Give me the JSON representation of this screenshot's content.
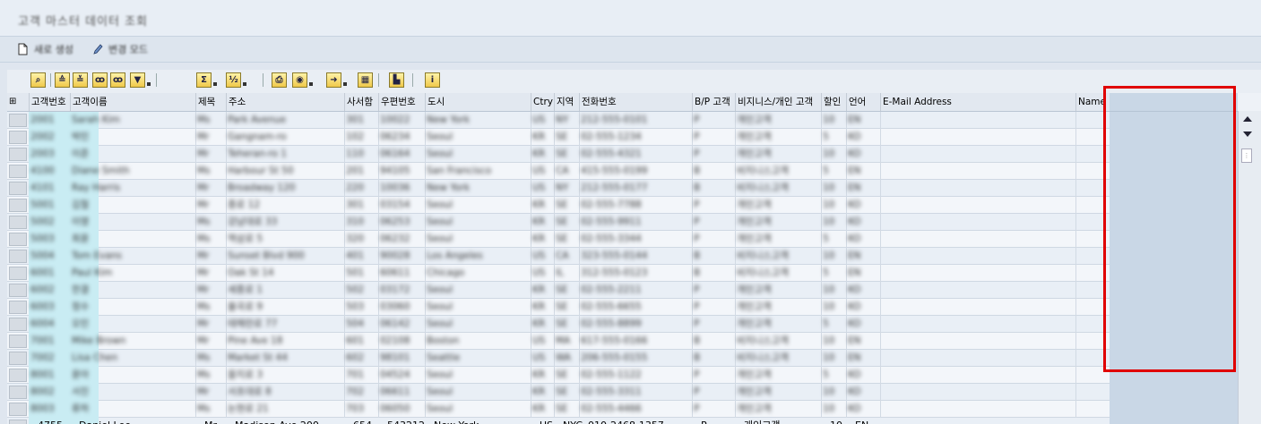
{
  "window": {
    "title": "고객 마스터 데이터 조회"
  },
  "actions": [
    {
      "label": "새로 생성",
      "icon": "new-document-icon"
    },
    {
      "label": "변경 모드",
      "icon": "pencil-icon"
    }
  ],
  "toolbar": {
    "buttons": [
      {
        "name": "details-button",
        "icon": "magnify-icon"
      },
      {
        "name": "sort-ascending-button",
        "icon": "sort-asc-icon"
      },
      {
        "name": "sort-descending-button",
        "icon": "sort-desc-icon"
      },
      {
        "name": "find-button",
        "icon": "binoculars-icon"
      },
      {
        "name": "find-next-button",
        "icon": "binoculars-next-icon"
      },
      {
        "name": "filter-button",
        "icon": "filter-icon"
      },
      {
        "name": "total-button",
        "icon": "sigma-icon"
      },
      {
        "name": "subtotal-button",
        "icon": "subtotal-icon"
      },
      {
        "name": "print-button",
        "icon": "printer-icon"
      },
      {
        "name": "views-button",
        "icon": "views-icon"
      },
      {
        "name": "export-button",
        "icon": "export-icon"
      },
      {
        "name": "layout-button",
        "icon": "grid-icon"
      },
      {
        "name": "graphic-button",
        "icon": "chart-icon"
      },
      {
        "name": "info-button",
        "icon": "info-icon"
      }
    ]
  },
  "table": {
    "columns": [
      "고객번호",
      "고객이름",
      "제목",
      "주소",
      "사서함",
      "우편번호",
      "도시",
      "Ctry",
      "지역",
      "전화번호",
      "B/P 고객",
      "비지니스/개인 고객",
      "할인",
      "언어",
      "E-Mail Address",
      "Name"
    ],
    "blurred_rows": [
      [
        "2001",
        "Sarah Kim",
        "Ms",
        "Park Avenue",
        "301",
        "10022",
        "New York",
        "US",
        "NY",
        "212-555-0101",
        "P",
        "개인고객",
        "10",
        "EN"
      ],
      [
        "2002",
        "박민",
        "Mr",
        "Gangnam-ro",
        "102",
        "06234",
        "Seoul",
        "KR",
        "SE",
        "02-555-1234",
        "P",
        "개인고객",
        "5",
        "KO"
      ],
      [
        "2003",
        "이준",
        "Mr",
        "Teheran-ro 1",
        "110",
        "06164",
        "Seoul",
        "KR",
        "SE",
        "02-555-4321",
        "P",
        "개인고객",
        "10",
        "KO"
      ],
      [
        "4100",
        "Diane Smith",
        "Ms",
        "Harbour St 50",
        "201",
        "94105",
        "San Francisco",
        "US",
        "CA",
        "415-555-0199",
        "B",
        "비지니스고객",
        "5",
        "EN"
      ],
      [
        "4101",
        "Ray Harris",
        "Mr",
        "Broadway 120",
        "220",
        "10036",
        "New York",
        "US",
        "NY",
        "212-555-0177",
        "B",
        "비지니스고객",
        "10",
        "EN"
      ],
      [
        "5001",
        "김철",
        "Mr",
        "종로 12",
        "301",
        "03154",
        "Seoul",
        "KR",
        "SE",
        "02-555-7788",
        "P",
        "개인고객",
        "10",
        "KO"
      ],
      [
        "5002",
        "이영",
        "Ms",
        "강남대로 33",
        "310",
        "06253",
        "Seoul",
        "KR",
        "SE",
        "02-555-9911",
        "P",
        "개인고객",
        "10",
        "KO"
      ],
      [
        "5003",
        "최윤",
        "Ms",
        "역삼로 5",
        "320",
        "06232",
        "Seoul",
        "KR",
        "SE",
        "02-555-3344",
        "P",
        "개인고객",
        "5",
        "KO"
      ],
      [
        "5004",
        "Tom Evans",
        "Mr",
        "Sunset Blvd 900",
        "401",
        "90028",
        "Los Angeles",
        "US",
        "CA",
        "323-555-0144",
        "B",
        "비지니스고객",
        "10",
        "EN"
      ],
      [
        "6001",
        "Paul Kim",
        "Mr",
        "Oak St 14",
        "501",
        "60611",
        "Chicago",
        "US",
        "IL",
        "312-555-0123",
        "B",
        "비지니스고객",
        "5",
        "EN"
      ],
      [
        "6002",
        "한결",
        "Mr",
        "세종로 1",
        "502",
        "03172",
        "Seoul",
        "KR",
        "SE",
        "02-555-2211",
        "P",
        "개인고객",
        "10",
        "KO"
      ],
      [
        "6003",
        "정수",
        "Ms",
        "율곡로 9",
        "503",
        "03060",
        "Seoul",
        "KR",
        "SE",
        "02-555-6655",
        "P",
        "개인고객",
        "10",
        "KO"
      ],
      [
        "6004",
        "오민",
        "Mr",
        "테헤란로 77",
        "504",
        "06142",
        "Seoul",
        "KR",
        "SE",
        "02-555-8899",
        "P",
        "개인고객",
        "5",
        "KO"
      ],
      [
        "7001",
        "Mike Brown",
        "Mr",
        "Pine Ave 18",
        "601",
        "02108",
        "Boston",
        "US",
        "MA",
        "617-555-0166",
        "B",
        "비지니스고객",
        "10",
        "EN"
      ],
      [
        "7002",
        "Lisa Chen",
        "Ms",
        "Market St 44",
        "602",
        "98101",
        "Seattle",
        "US",
        "WA",
        "206-555-0155",
        "B",
        "비지니스고객",
        "10",
        "EN"
      ],
      [
        "8001",
        "윤아",
        "Ms",
        "을지로 3",
        "701",
        "04524",
        "Seoul",
        "KR",
        "SE",
        "02-555-1122",
        "P",
        "개인고객",
        "5",
        "KO"
      ],
      [
        "8002",
        "서진",
        "Mr",
        "서초대로 8",
        "702",
        "06611",
        "Seoul",
        "KR",
        "SE",
        "02-555-3311",
        "P",
        "개인고객",
        "10",
        "KO"
      ],
      [
        "8003",
        "류하",
        "Ms",
        "논현로 21",
        "703",
        "06050",
        "Seoul",
        "KR",
        "SE",
        "02-555-4466",
        "P",
        "개인고객",
        "10",
        "KO"
      ]
    ],
    "last_row": [
      "4755",
      "Daniel Lee",
      "Mr",
      "Madison Ave 200",
      "654",
      "543212",
      "New York",
      "US",
      "NYC",
      "010-2468-1357",
      "P",
      "개인고객",
      "10",
      "EN"
    ]
  }
}
